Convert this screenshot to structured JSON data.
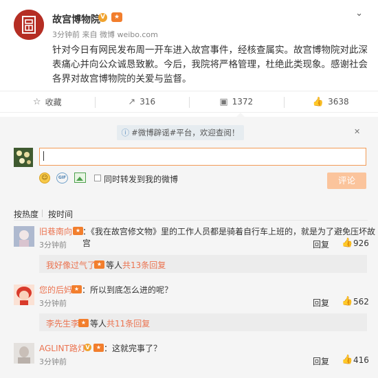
{
  "post": {
    "author": "故宫博物院",
    "verified_mark": "V",
    "meta": "3分钟前 来自 微博 weibo.com",
    "text": "针对今日有网民发布周一开车进入故宫事件，经核查属实。故宫博物院对此深表痛心并向公众诚恳致歉。今后，我院将严格管理，杜绝此类现象。感谢社会各界对故宫博物院的关爱与监督。",
    "avatar_seal": "囘"
  },
  "actions": {
    "favorite_label": "收藏",
    "repost_count": "316",
    "comment_count": "1372",
    "like_count": "3638"
  },
  "notice": {
    "text": "#微博辟谣#平台，欢迎查阅！",
    "close": "✕"
  },
  "composer": {
    "repost_label": "同时转发到我的微博",
    "submit_label": "评论",
    "gif_label": "GIF"
  },
  "sort": {
    "hot": "按热度",
    "time": "按时间"
  },
  "comments": [
    {
      "user": "旧巷南向",
      "text": "：《我在故宫修文物》里的工作人员都是骑着自行车上班的，就是为了避免压坏故宫",
      "time": "3分钟前",
      "reply_label": "回复",
      "likes": "926",
      "sub_user": "我好像过气了",
      "sub_text": "等人",
      "sub_count": "共13条回复"
    },
    {
      "user": "您的后妈",
      "text": "：所以到底怎么进的呢？",
      "time": "3分钟前",
      "reply_label": "回复",
      "likes": "562",
      "sub_user": "李先生李",
      "sub_text": "等人",
      "sub_count": "共11条回复"
    },
    {
      "user": "AGLINT路灯",
      "verified_mark": "V",
      "text": "：这就完事了？",
      "time": "3分钟前",
      "reply_label": "回复",
      "likes": "416"
    }
  ],
  "colors": {
    "accent": "#eb7350",
    "brand_seal": "#b52e24",
    "submit_disabled": "#fbc49c"
  }
}
